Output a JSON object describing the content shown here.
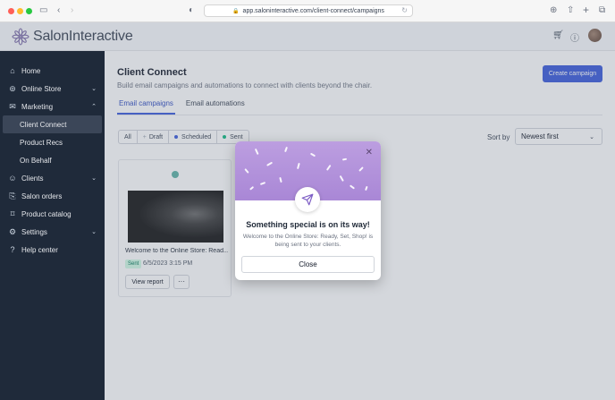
{
  "browser": {
    "url": "app.saloninteractive.com/client-connect/campaigns"
  },
  "header": {
    "brand": "SalonInteractive",
    "icons": [
      "cart-icon",
      "help-icon",
      "avatar"
    ]
  },
  "sidebar": {
    "items": [
      {
        "label": "Home",
        "icon": "home-icon"
      },
      {
        "label": "Online Store",
        "icon": "store-icon",
        "expandable": true
      },
      {
        "label": "Marketing",
        "icon": "marketing-icon",
        "expandable": true,
        "expanded": true
      },
      {
        "label": "Client Connect",
        "sub": true,
        "active": true
      },
      {
        "label": "Product Recs",
        "sub": true
      },
      {
        "label": "On Behalf",
        "sub": true
      },
      {
        "label": "Clients",
        "icon": "clients-icon",
        "expandable": true
      },
      {
        "label": "Salon orders",
        "icon": "orders-icon"
      },
      {
        "label": "Product catalog",
        "icon": "catalog-icon"
      },
      {
        "label": "Settings",
        "icon": "settings-icon",
        "expandable": true
      },
      {
        "label": "Help center",
        "icon": "help-icon"
      }
    ]
  },
  "main": {
    "title": "Client Connect",
    "subtitle": "Build email campaigns and automations to connect with clients beyond the chair.",
    "create_button": "Create campaign",
    "tabs": [
      {
        "label": "Email campaigns",
        "active": true
      },
      {
        "label": "Email automations",
        "active": false
      }
    ],
    "filters": [
      {
        "label": "All"
      },
      {
        "label": "Draft",
        "marker": "+",
        "color": "#9ca3af"
      },
      {
        "label": "Scheduled",
        "marker": "dot",
        "color": "#3b5bdb"
      },
      {
        "label": "Sent",
        "marker": "dot",
        "color": "#10b981"
      }
    ],
    "sort_label": "Sort by",
    "sort_value": "Newest first"
  },
  "card": {
    "title": "Welcome to the Online Store: Read...",
    "status": "Sent",
    "date": "6/5/2023 3:15 PM",
    "view_button": "View report",
    "more_button": "···"
  },
  "modal": {
    "title": "Something special is on its way!",
    "body": "Welcome to the Online Store: Ready, Set, Shop! is being sent to your clients.",
    "close_button": "Close",
    "banner_color": "#b695dd"
  }
}
